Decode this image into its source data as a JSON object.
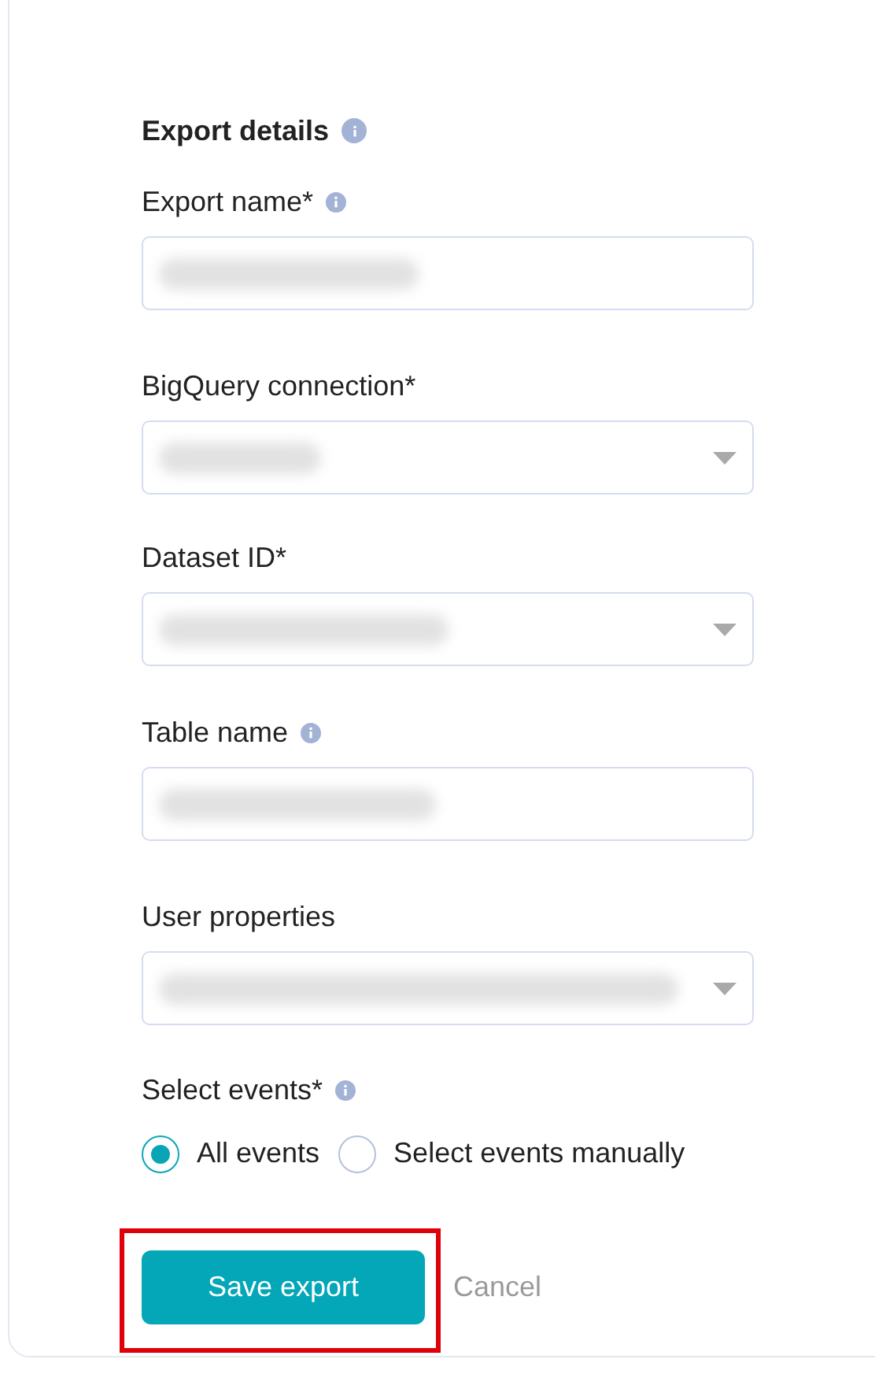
{
  "section": {
    "title": "Export details",
    "info": true
  },
  "fields": [
    {
      "label": "Export name*",
      "info": true,
      "kind": "text",
      "value_blurred": true
    },
    {
      "label": "BigQuery connection*",
      "info": false,
      "kind": "select",
      "value_blurred": true
    },
    {
      "label": "Dataset ID*",
      "info": false,
      "kind": "select",
      "value_blurred": true
    },
    {
      "label": "Table name",
      "info": true,
      "kind": "text",
      "value_blurred": true
    },
    {
      "label": "User properties",
      "info": false,
      "kind": "select",
      "value_blurred": true
    }
  ],
  "events": {
    "label": "Select events*",
    "info": true,
    "options": [
      {
        "label": "All events",
        "selected": true
      },
      {
        "label": "Select events manually",
        "selected": false
      }
    ]
  },
  "actions": {
    "save": {
      "label": "Save export",
      "highlighted": true
    },
    "cancel": {
      "label": "Cancel"
    }
  }
}
